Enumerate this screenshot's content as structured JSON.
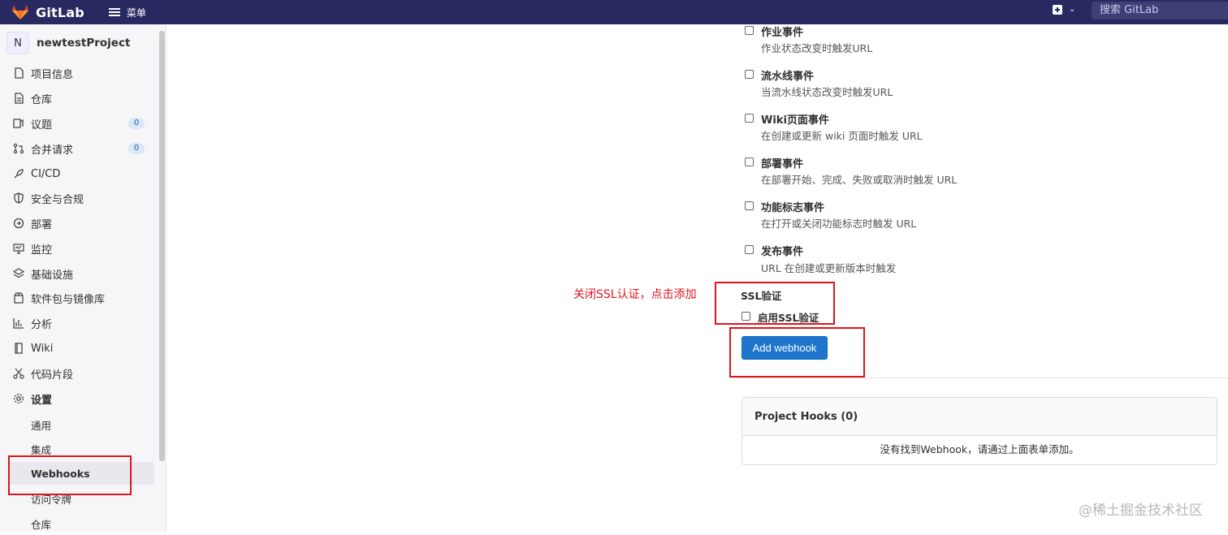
{
  "topbar": {
    "logo_text": "GitLab",
    "menu_label": "菜单",
    "search_placeholder": "搜索 GitLab",
    "caret": "⌄"
  },
  "sidebar": {
    "project_initial": "N",
    "project_name": "newtestProject",
    "items": [
      {
        "icon": "info-icon",
        "label": "项目信息"
      },
      {
        "icon": "doc-icon",
        "label": "仓库"
      },
      {
        "icon": "issues-icon",
        "label": "议题",
        "badge": "0"
      },
      {
        "icon": "merge-icon",
        "label": "合并请求",
        "badge": "0"
      },
      {
        "icon": "rocket-icon",
        "label": "CI/CD"
      },
      {
        "icon": "shield-icon",
        "label": "安全与合规"
      },
      {
        "icon": "deploy-icon",
        "label": "部署"
      },
      {
        "icon": "monitor-icon",
        "label": "监控"
      },
      {
        "icon": "infra-icon",
        "label": "基础设施"
      },
      {
        "icon": "package-icon",
        "label": "软件包与镜像库"
      },
      {
        "icon": "chart-icon",
        "label": "分析"
      },
      {
        "icon": "book-icon",
        "label": "Wiki"
      },
      {
        "icon": "snippet-icon",
        "label": "代码片段"
      },
      {
        "icon": "gear-icon",
        "label": "设置"
      }
    ],
    "settings_sub": [
      "通用",
      "集成",
      "Webhooks",
      "访问令牌",
      "仓库"
    ]
  },
  "events": [
    {
      "title": "作业事件",
      "desc": "作业状态改变时触发URL"
    },
    {
      "title": "流水线事件",
      "desc": "当流水线状态改变时触发URL"
    },
    {
      "title": "Wiki页面事件",
      "desc": "在创建或更新 wiki 页面时触发 URL"
    },
    {
      "title": "部署事件",
      "desc": "在部署开始、完成、失败或取消时触发 URL"
    },
    {
      "title": "功能标志事件",
      "desc": "在打开或关闭功能标志时触发 URL"
    },
    {
      "title": "发布事件",
      "desc": "URL 在创建或更新版本时触发"
    }
  ],
  "ssl": {
    "section_label": "SSL验证",
    "checkbox_label": "启用SSL验证"
  },
  "add_button": "Add webhook",
  "hooks": {
    "title": "Project Hooks (0)",
    "empty_text": "没有找到Webhook，请通过上面表单添加。"
  },
  "annotation": {
    "note": "关闭SSL认证，点击添加",
    "color": "#e0141e"
  },
  "watermark": "@稀土掘金技术社区"
}
